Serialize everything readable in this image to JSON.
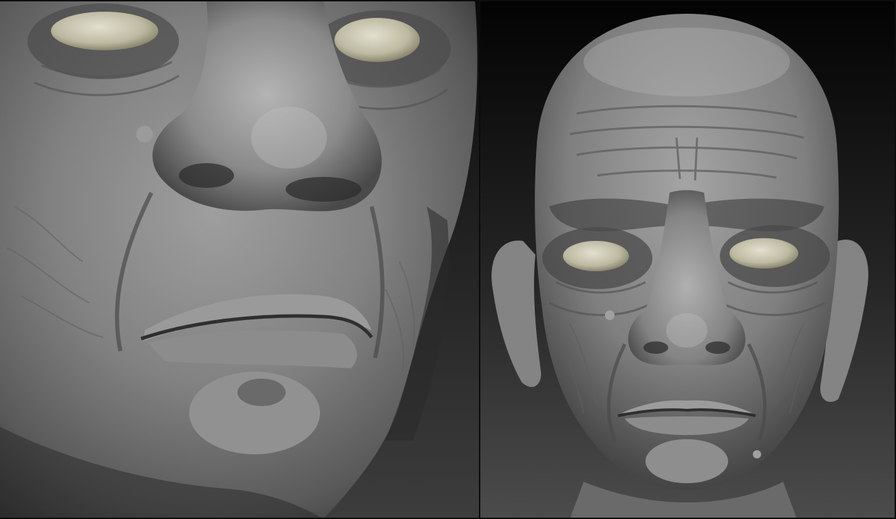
{
  "scene": {
    "description_free": true,
    "colors": {
      "clay_light": "#a9a9a9",
      "clay_mid": "#7d7d7d",
      "clay_dark": "#3a3a3a",
      "eye_light": "#d8d6c4",
      "eye_mid": "#b7b49c",
      "bg_top": "#050505",
      "bg_bottom": "#4a4a4a"
    }
  }
}
